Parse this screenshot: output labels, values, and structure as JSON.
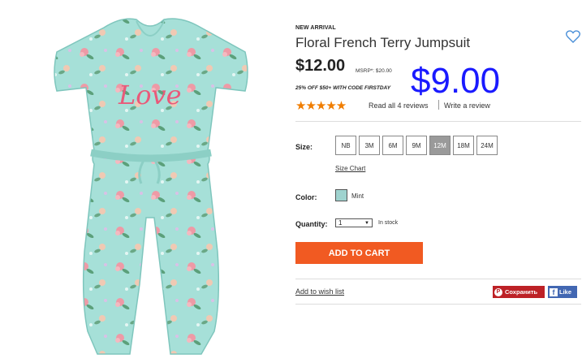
{
  "product": {
    "badge": "NEW ARRIVAL",
    "title": "Floral French Terry Jumpsuit",
    "image_text": "Love",
    "price": "$12.00",
    "msrp": "MSRP*: $20.00",
    "promo": "25% OFF $50+ WITH CODE FIRSTDAY",
    "overlay_price": "$9.00",
    "rating": 5,
    "stars": "★★★★★",
    "reviews_link": "Read all 4 reviews",
    "write_review": "Write a review"
  },
  "size": {
    "label": "Size:",
    "options": [
      "NB",
      "3M",
      "6M",
      "9M",
      "12M",
      "18M",
      "24M"
    ],
    "selected": "12M",
    "chart_link": "Size Chart"
  },
  "color": {
    "label": "Color:",
    "name": "Mint",
    "swatch_hex": "#9fd3cf"
  },
  "quantity": {
    "label": "Quantity:",
    "value": "1",
    "stock": "In stock"
  },
  "actions": {
    "add_to_cart": "ADD TO CART",
    "wish_list": "Add to wish list",
    "pinterest": "Сохранить",
    "facebook": "Like"
  },
  "colors": {
    "accent": "#f15a22",
    "star": "#f07d00",
    "overlay": "#1a1aff",
    "pinterest": "#bd2126",
    "facebook": "#4267b2"
  }
}
